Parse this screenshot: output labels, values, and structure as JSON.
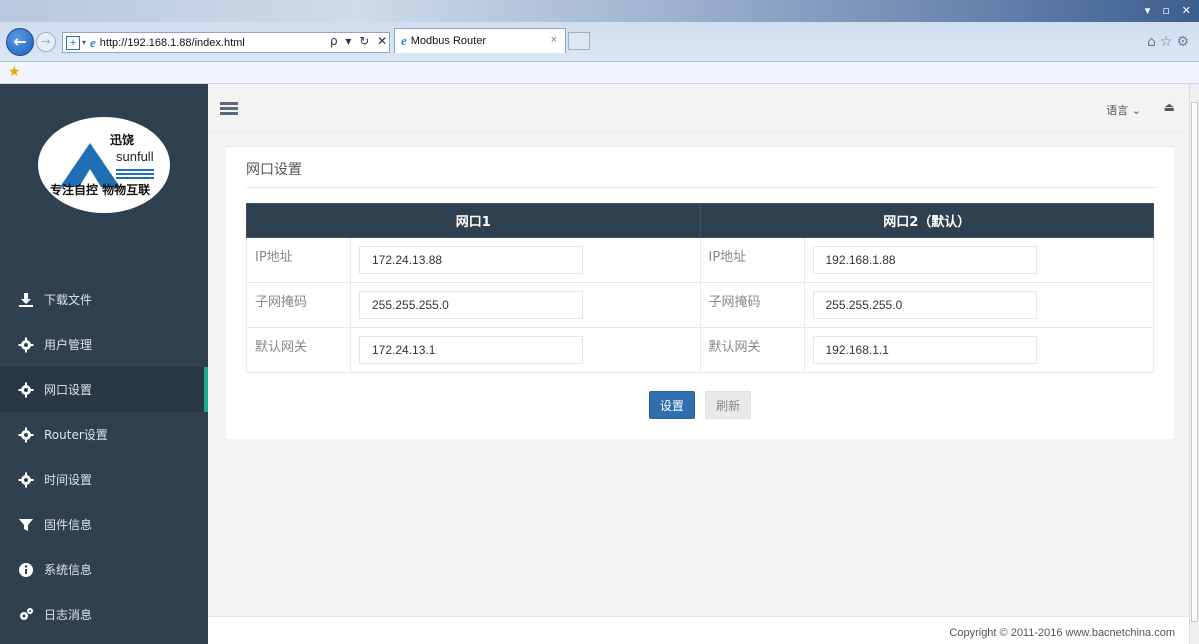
{
  "browser": {
    "url": "http://192.168.1.88/index.html",
    "tab_title": "Modbus Router",
    "tab_close": "×",
    "addr_tools": "ρ ▾ ↻ ✕"
  },
  "topbar": {
    "lang": "语言 ⌄",
    "logout_icon": "⏏"
  },
  "logo": {
    "cn": "迅饶",
    "en": "sunfull",
    "slogan": "专注自控 物物互联"
  },
  "sidebar": {
    "items": [
      {
        "label": "下载文件",
        "icon": "download-icon"
      },
      {
        "label": "用户管理",
        "icon": "gear-icon"
      },
      {
        "label": "网口设置",
        "icon": "gear-icon",
        "active": true
      },
      {
        "label": "Router设置",
        "icon": "gear-icon"
      },
      {
        "label": "时间设置",
        "icon": "gear-icon"
      },
      {
        "label": "固件信息",
        "icon": "filter-icon"
      },
      {
        "label": "系统信息",
        "icon": "info-icon"
      },
      {
        "label": "日志消息",
        "icon": "gears-icon"
      }
    ]
  },
  "panel": {
    "title": "网口设置",
    "col1_header": "网口1",
    "col2_header": "网口2（默认）",
    "rows": [
      {
        "label1": "IP地址",
        "value1": "172.24.13.88",
        "label2": "IP地址",
        "value2": "192.168.1.88"
      },
      {
        "label1": "子网掩码",
        "value1": "255.255.255.0",
        "label2": "子网掩码",
        "value2": "255.255.255.0"
      },
      {
        "label1": "默认网关",
        "value1": "172.24.13.1",
        "label2": "默认网关",
        "value2": "192.168.1.1"
      }
    ],
    "set_button": "设置",
    "refresh_button": "刷新"
  },
  "footer": {
    "copyright": "Copyright © 2011-2016 www.bacnetchina.com"
  }
}
